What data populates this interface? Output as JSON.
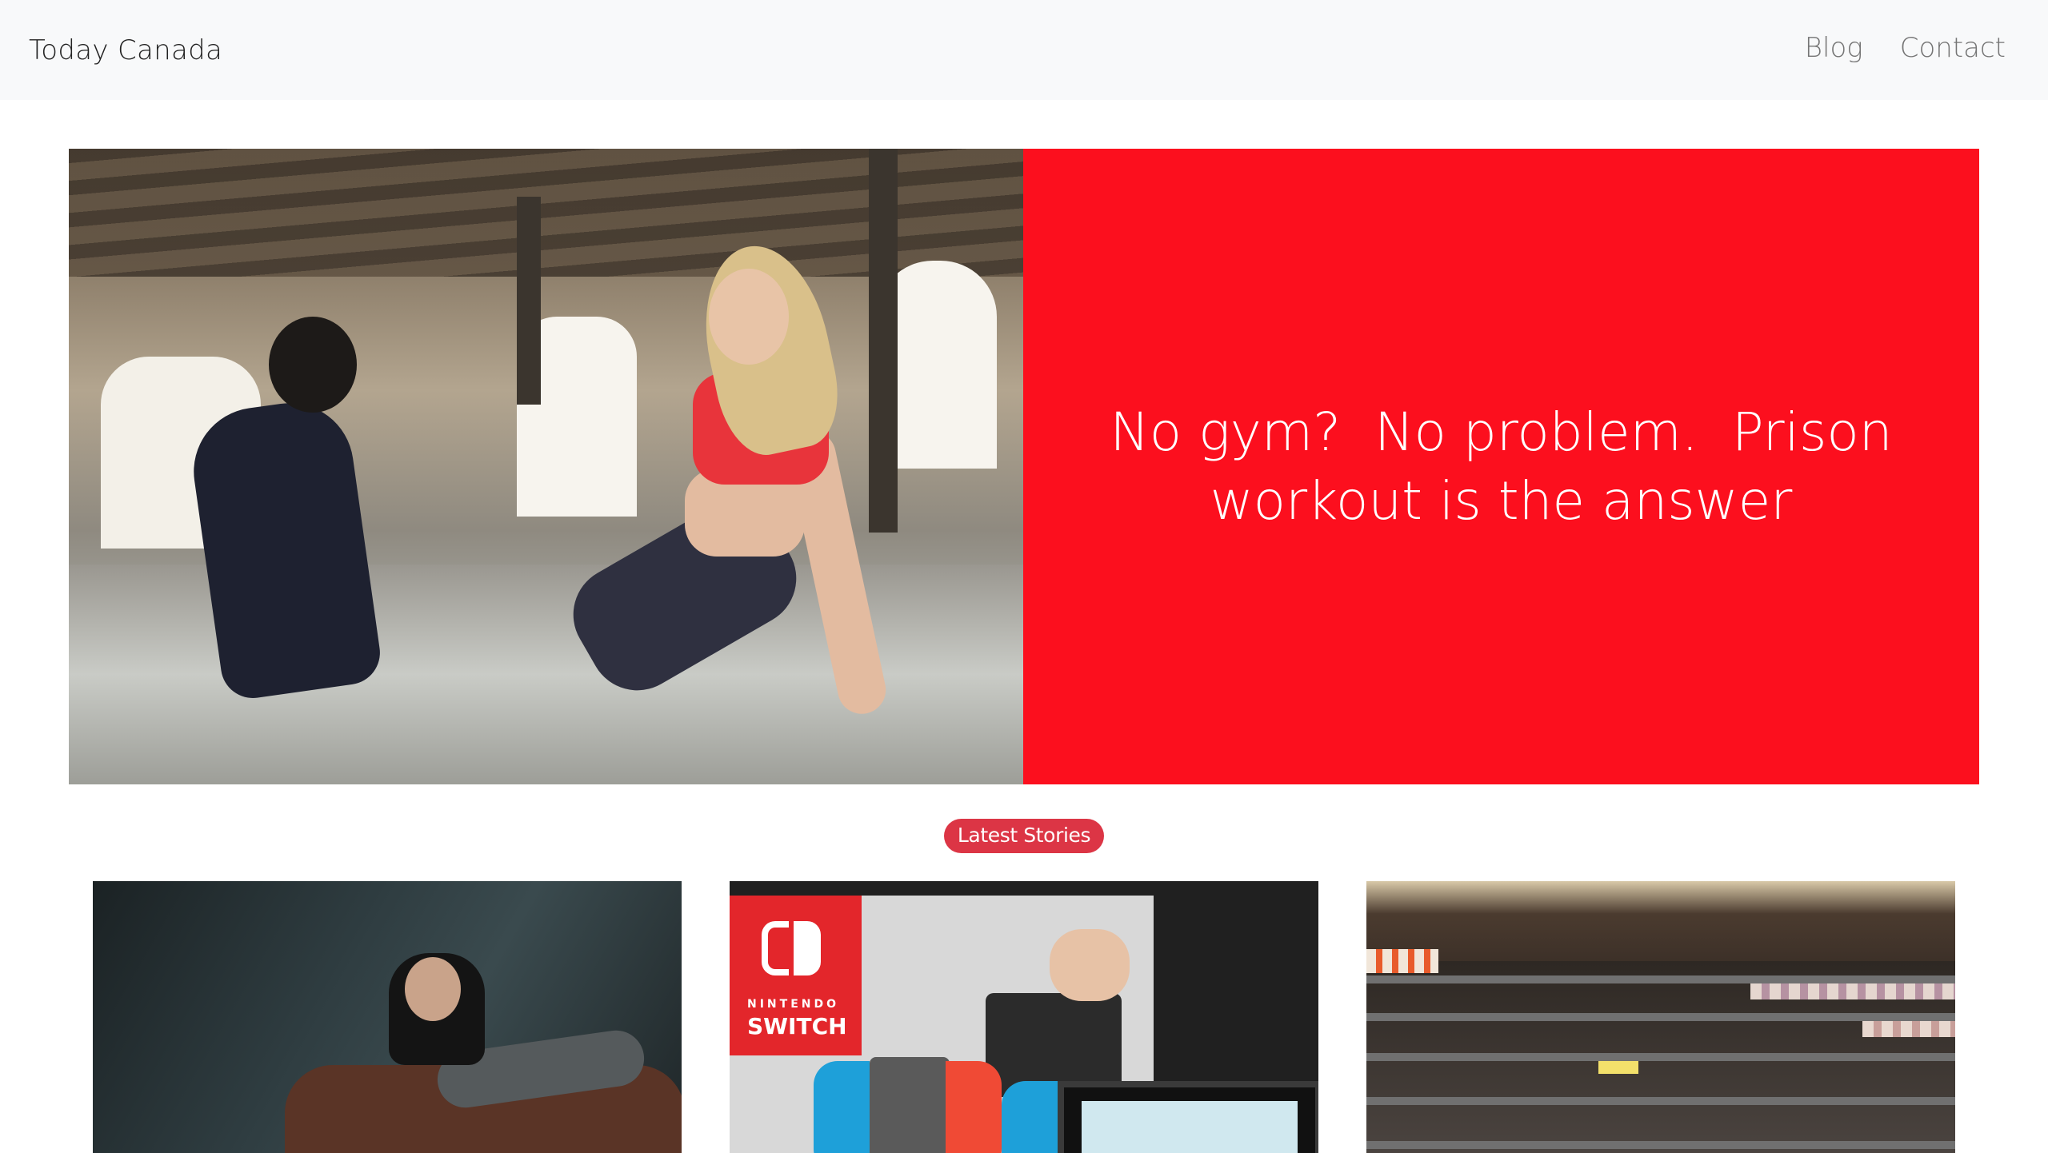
{
  "navbar": {
    "brand": "Today Canada",
    "links": [
      {
        "label": "Blog"
      },
      {
        "label": "Contact"
      }
    ]
  },
  "hero": {
    "headline": "No gym?  No problem.  Prison workout is the answer",
    "panel_color": "#fc0f1e"
  },
  "latest": {
    "badge": "Latest Stories",
    "badge_color": "#dc3545"
  },
  "cards": [
    {
      "image": "man-on-leather-sofa-photo"
    },
    {
      "image": "nintendo-switch-box-photo",
      "logo_text_top": "NINTENDO",
      "logo_text_bottom": "SWITCH"
    },
    {
      "image": "empty-grocery-shelves-photo"
    }
  ]
}
